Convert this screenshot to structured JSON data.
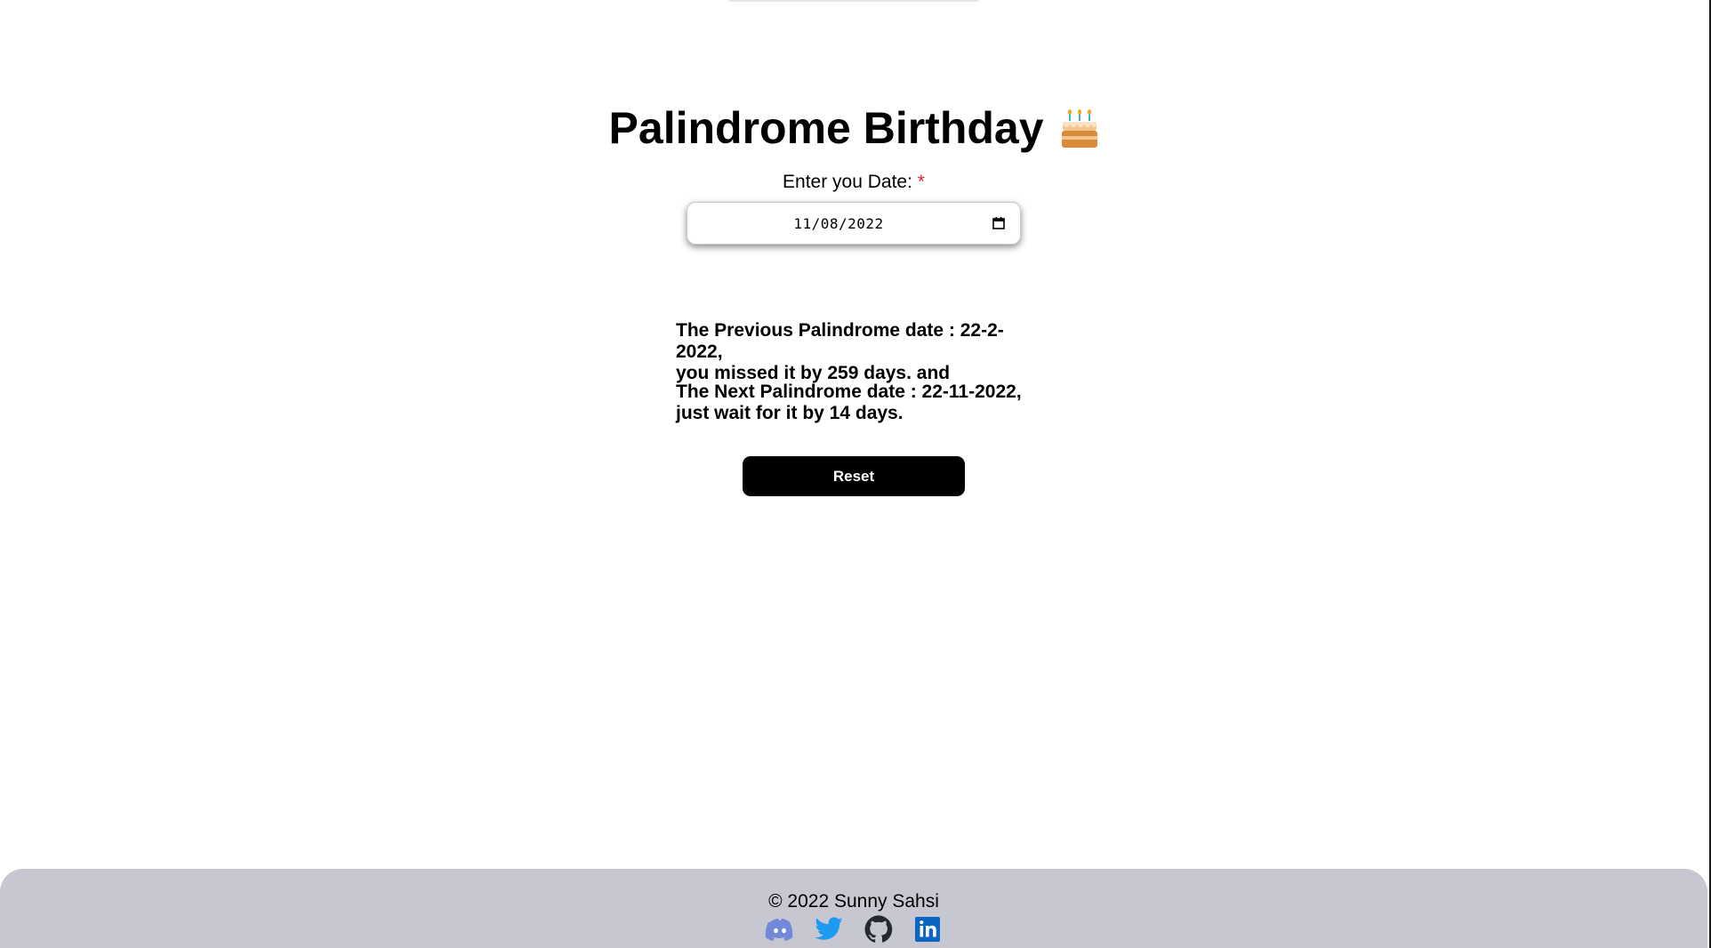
{
  "header": {
    "title": "Palindrome Birthday"
  },
  "form": {
    "date_label": "Enter you Date:",
    "required_mark": "*",
    "date_value": "11/08/2022",
    "reset_label": "Reset"
  },
  "result": {
    "previous_line1": "The Previous Palindrome date : 22-2-2022,",
    "previous_line2": "you missed it by 259 days. and",
    "next_line1": "The Next Palindrome date : 22-11-2022,",
    "next_line2": "just wait for it by 14 days."
  },
  "footer": {
    "copyright": "© 2022 Sunny Sahsi",
    "social_icons": [
      "discord-icon",
      "twitter-icon",
      "github-icon",
      "linkedin-icon"
    ]
  },
  "colors": {
    "footer_bg": "#c7c7d1",
    "button_bg": "#000000",
    "required": "#e02424",
    "discord": "#7289da",
    "twitter": "#1d9bf0",
    "github": "#24292e",
    "linkedin": "#0a66c2"
  }
}
